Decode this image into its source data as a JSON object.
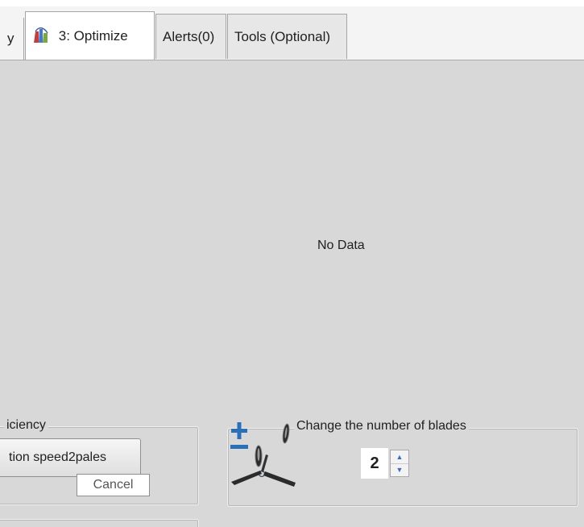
{
  "tabs": {
    "partial_label": "y",
    "optimize_label": "3: Optimize",
    "alerts_label": "Alerts(0)",
    "tools_label": "Tools (Optional)"
  },
  "main": {
    "no_data_text": "No Data"
  },
  "efficiency_group": {
    "legend": "iciency",
    "speed_button_label": "tion speed2pales",
    "cancel_label": "Cancel"
  },
  "blades_group": {
    "legend": "Change the number of blades",
    "blade_count": "2"
  },
  "icons": {
    "optimize_tab_icon": "optimize-chart-icon",
    "plus_minus_icon": "plus-minus-icon",
    "propeller_icon": "propeller-icon",
    "spin_up_icon": "arrow-up-icon",
    "spin_down_icon": "arrow-down-icon"
  },
  "colors": {
    "accent_blue": "#2a6fb8",
    "panel_gray": "#d8d8d8"
  }
}
